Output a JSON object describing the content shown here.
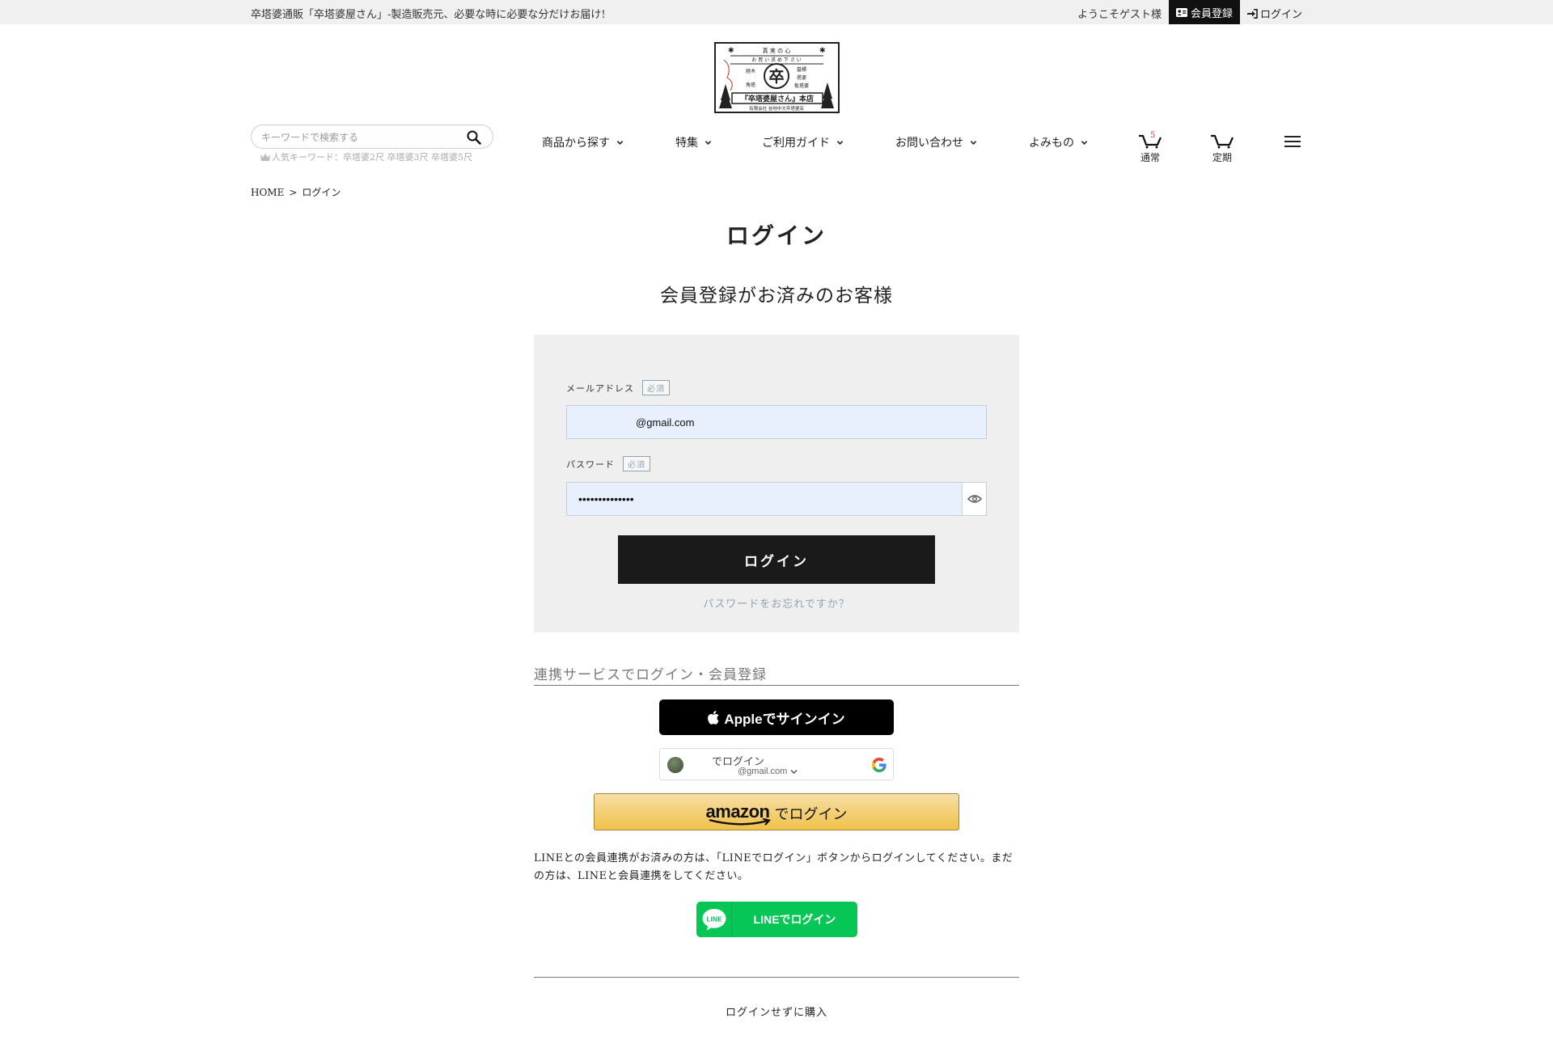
{
  "topbar": {
    "message": "卒塔婆通販「卒塔婆屋さん」-製造販売元、必要な時に必要な分だけお届け!",
    "welcome": "ようこそゲスト様",
    "register": "会員登録",
    "login": "ログイン"
  },
  "logo": {
    "lines": [
      "真 実 の 心",
      "お 買 い 求 め 下 さ い",
      "卒",
      "『卒塔婆屋さん』本店",
      "有限会社 谷地中大卒塔婆店"
    ],
    "side_left": [
      "経木",
      "角塔"
    ],
    "side_right": [
      "墓標",
      "塔婆",
      "板塔婆"
    ]
  },
  "search": {
    "placeholder": "キーワードで検索する",
    "popular": "人気キーワード：卒塔婆2尺 卒塔婆3尺 卒塔婆5尺"
  },
  "nav": {
    "items": [
      "商品から探す",
      "特集",
      "ご利用ガイド",
      "お問い合わせ",
      "よみもの"
    ],
    "cart_regular": "通常",
    "cart_badge": "5",
    "cart_subscription": "定期"
  },
  "breadcrumb": {
    "home": "HOME",
    "separator": ">",
    "current": "ログイン"
  },
  "page": {
    "title": "ログイン",
    "subtitle": "会員登録がお済みのお客様"
  },
  "form": {
    "email_label": "メールアドレス",
    "required": "必須",
    "email_value": "@gmail.com",
    "password_label": "パスワード",
    "password_value": "••••••••••••••",
    "login_button": "ログイン",
    "forgot": "パスワードをお忘れですか？"
  },
  "social": {
    "title": "連携サービスでログイン・会員登録",
    "apple": "Appleでサインイン",
    "google_line1": "でログイン",
    "google_line2": "@gmail.com",
    "amazon_logo": "amazon",
    "amazon_label": "でログイン",
    "line_text": "LINEとの会員連携がお済みの方は、「LINEでログイン」ボタンからログインしてください。まだの方は、LINEと会員連携をしてください。",
    "line_icon": "LINE",
    "line_button": "LINEでログイン"
  },
  "guest": {
    "link": "ログインせずに購入"
  },
  "colors": {
    "accent_link": "#8da3ba",
    "line_green": "#06c755",
    "amazon_yellow": "#f0c14b"
  }
}
